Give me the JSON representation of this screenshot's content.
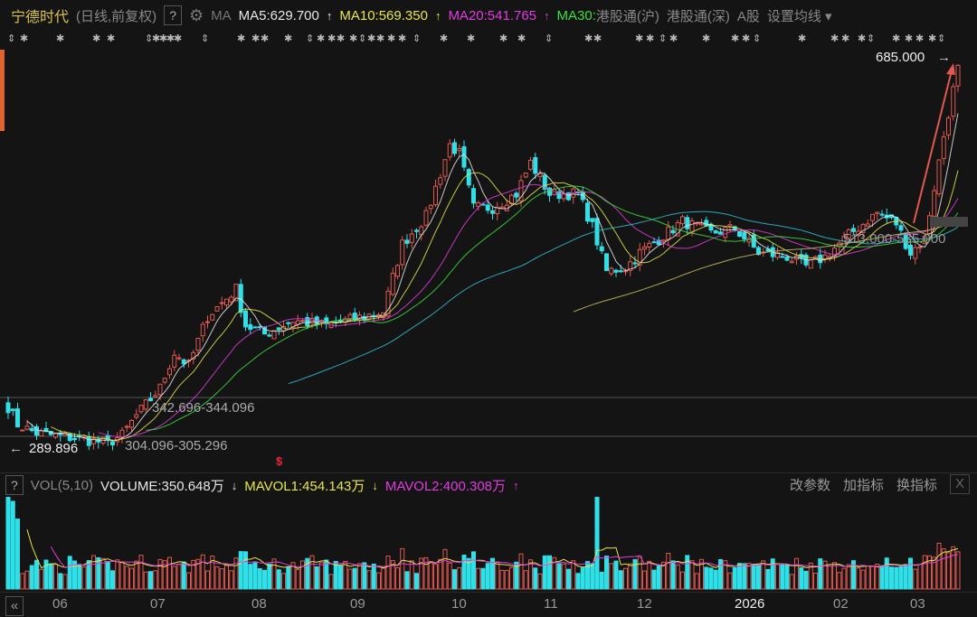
{
  "header": {
    "stock_name": "宁德时代",
    "period": "(日线,前复权)",
    "help": "?",
    "ma_label": "MA",
    "ma5": "MA5:629.700",
    "ma5_dir": "↑",
    "ma10": "MA10:569.350",
    "ma10_dir": "↑",
    "ma20": "MA20:541.765",
    "ma20_dir": "↑",
    "ma30": "MA30:",
    "hk_sh": "港股通(沪)",
    "hk_sz": "港股通(深)",
    "a_share": "A股",
    "settings": "设置均线 ▾"
  },
  "annotations": {
    "high": "685.000",
    "low": "289.896",
    "range1": "342.696-344.096",
    "range2": "304.096-305.296",
    "range3": "513.000-535.000",
    "signal": "$"
  },
  "volume": {
    "help": "?",
    "label": "VOL(5,10)",
    "volume": "VOLUME:350.648万",
    "volume_dir": "↓",
    "mavol1": "MAVOL1:454.143万",
    "mavol1_dir": "↓",
    "mavol2": "MAVOL2:400.308万",
    "mavol2_dir": "↑",
    "btn_params": "改参数",
    "btn_add": "加指标",
    "btn_switch": "换指标",
    "btn_close": "X"
  },
  "xaxis": {
    "collapse": "«",
    "months": [
      "06",
      "07",
      "08",
      "09",
      "10",
      "11",
      "12",
      "2026",
      "02",
      "03"
    ]
  },
  "colors": {
    "up": "#e0584f",
    "down": "#2fe0e8",
    "ma5": "#e8e8e8",
    "ma10": "#e6e64a",
    "ma20": "#e13ce0",
    "ma30": "#3ce03c"
  },
  "chart_data": {
    "type": "candlestick",
    "days": 200,
    "price_range": [
      289.896,
      685.0
    ],
    "close_keypoints": [
      [
        0,
        333
      ],
      [
        2,
        315
      ],
      [
        6,
        306
      ],
      [
        14,
        301
      ],
      [
        21,
        296
      ],
      [
        24,
        304
      ],
      [
        27,
        324
      ],
      [
        32,
        352
      ],
      [
        35,
        388
      ],
      [
        38,
        375
      ],
      [
        42,
        425
      ],
      [
        48,
        453
      ],
      [
        50,
        416
      ],
      [
        54,
        407
      ],
      [
        60,
        421
      ],
      [
        67,
        416
      ],
      [
        75,
        425
      ],
      [
        79,
        430
      ],
      [
        83,
        499
      ],
      [
        88,
        527
      ],
      [
        93,
        600
      ],
      [
        95,
        591
      ],
      [
        98,
        536
      ],
      [
        102,
        536
      ],
      [
        107,
        550
      ],
      [
        110,
        582
      ],
      [
        114,
        550
      ],
      [
        120,
        550
      ],
      [
        123,
        517
      ],
      [
        126,
        471
      ],
      [
        130,
        475
      ],
      [
        133,
        490
      ],
      [
        137,
        504
      ],
      [
        142,
        522
      ],
      [
        148,
        510
      ],
      [
        153,
        515
      ],
      [
        158,
        490
      ],
      [
        164,
        486
      ],
      [
        168,
        476
      ],
      [
        172,
        486
      ],
      [
        177,
        508
      ],
      [
        183,
        531
      ],
      [
        187,
        520
      ],
      [
        190,
        490
      ],
      [
        193,
        504
      ],
      [
        197,
        609
      ],
      [
        199,
        656
      ],
      [
        200,
        681
      ]
    ]
  }
}
